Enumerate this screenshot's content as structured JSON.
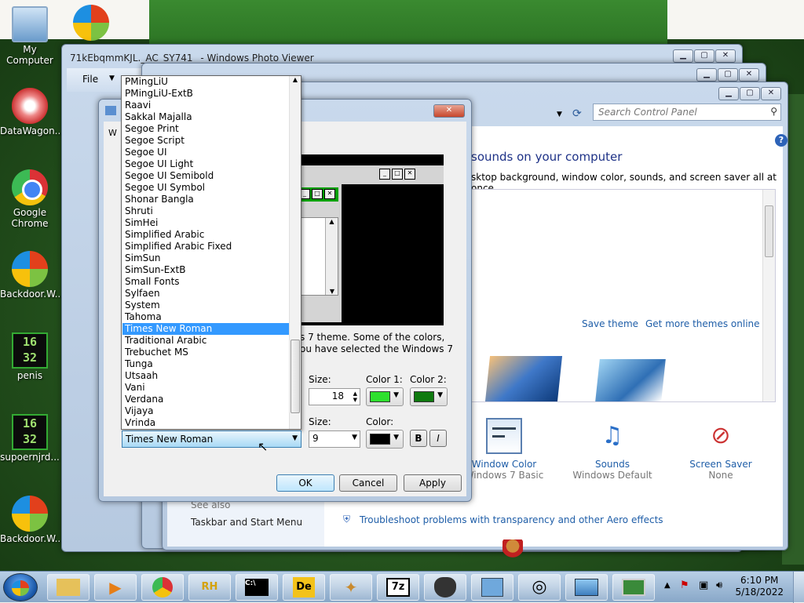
{
  "desktop": {
    "icons": [
      {
        "label": "My Computer",
        "icon": "computer-icon"
      },
      {
        "label": "",
        "icon": "windows-logo-icon"
      },
      {
        "label": "DataWagon...",
        "icon": "datawagon-icon"
      },
      {
        "label": "Google Chrome",
        "icon": "chrome-icon"
      },
      {
        "label": "Backdoor.W...",
        "icon": "windows-logo-icon"
      },
      {
        "label": "penis",
        "icon": "clock-16-32-icon"
      },
      {
        "label": "supoernjrd...",
        "icon": "clock-16-32-icon"
      },
      {
        "label": "Backdoor.W...",
        "icon": "windows-logo-icon"
      }
    ],
    "clock_icon_text": [
      "16",
      "32"
    ]
  },
  "photo_viewer": {
    "title": "71kEbqmmKJL._AC_SY741_ - Windows Photo Viewer",
    "menu_file": "File"
  },
  "control_panel": {
    "search_placeholder": "Search Control Panel",
    "heading": "sounds on your computer",
    "subheading": "sktop background, window color, sounds, and screen saver all at once.",
    "save_theme": "Save theme",
    "get_more_themes": "Get more themes online",
    "items": [
      {
        "name": "Window Color",
        "value": "Windows 7 Basic",
        "icon": "window-color-icon"
      },
      {
        "name": "Sounds",
        "value": "Windows Default",
        "icon": "sounds-icon"
      },
      {
        "name": "Screen Saver",
        "value": "None",
        "icon": "screen-saver-icon"
      }
    ],
    "see_also": "See also",
    "taskbar_link": "Taskbar and Start Menu",
    "troubleshoot": "Troubleshoot problems with transparency and other Aero effects"
  },
  "dialog": {
    "description_line1": "s 7 theme.  Some of the colors,",
    "description_line2": "ou have selected the Windows 7",
    "item_size_label": "Size:",
    "item_size_value": "18",
    "color1_label": "Color 1:",
    "color2_label": "Color 2:",
    "color1": "#2ee02e",
    "color2": "#0f7a0f",
    "font_size_label": "Size:",
    "font_size_value": "9",
    "font_color_label": "Color:",
    "font_color": "#000000",
    "bold_label": "B",
    "italic_label": "I",
    "ok": "OK",
    "cancel": "Cancel",
    "apply": "Apply"
  },
  "font_list": {
    "items": [
      "PMingLiU",
      "PMingLiU-ExtB",
      "Raavi",
      "Sakkal Majalla",
      "Segoe Print",
      "Segoe Script",
      "Segoe UI",
      "Segoe UI Light",
      "Segoe UI Semibold",
      "Segoe UI Symbol",
      "Shonar Bangla",
      "Shruti",
      "SimHei",
      "Simplified Arabic",
      "Simplified Arabic Fixed",
      "SimSun",
      "SimSun-ExtB",
      "Small Fonts",
      "Sylfaen",
      "System",
      "Tahoma",
      "Times New Roman",
      "Traditional Arabic",
      "Trebuchet MS",
      "Tunga",
      "Utsaah",
      "Vani",
      "Verdana",
      "Vijaya",
      "Vrinda"
    ],
    "selected_index": 21,
    "selected_value": "Times New Roman"
  },
  "taskbar": {
    "apps": [
      "file-explorer-icon",
      "media-player-icon",
      "chrome-icon",
      "rh-icon",
      "cmd-icon",
      "de-icon",
      "puzzle-icon",
      "7zip-icon",
      "wolf-icon",
      "control-panel-icon",
      "globe-icon",
      "photo-viewer-icon",
      "display-icon"
    ],
    "rh_label": "RH",
    "de_label": "De",
    "zip_label": "7z",
    "time": "6:10 PM",
    "date": "5/18/2022"
  },
  "colors": {
    "accent": "#3399ff",
    "link": "#1f5ea8",
    "preview_active_title": "#00a000"
  }
}
